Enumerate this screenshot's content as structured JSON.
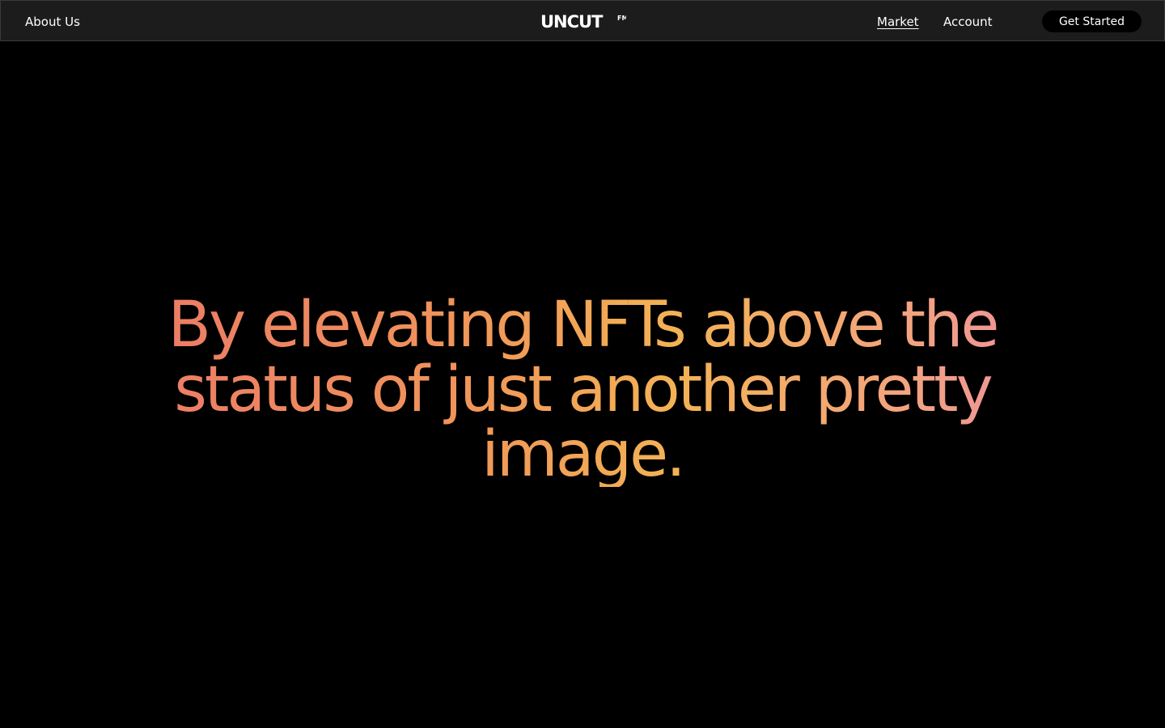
{
  "header": {
    "about_label": "About Us",
    "logo_text": "UNCUT",
    "logo_superscript": "FM",
    "market_label": "Market",
    "account_label": "Account",
    "cta_label": "Get Started"
  },
  "hero": {
    "headline": "By elevating NFTs above the status of just another pretty image."
  },
  "colors": {
    "background": "#000000",
    "topbar": "#1c1c1c",
    "gradient_start": "#ec7a67",
    "gradient_mid": "#f3b255",
    "gradient_end": "#ee8fa0"
  }
}
